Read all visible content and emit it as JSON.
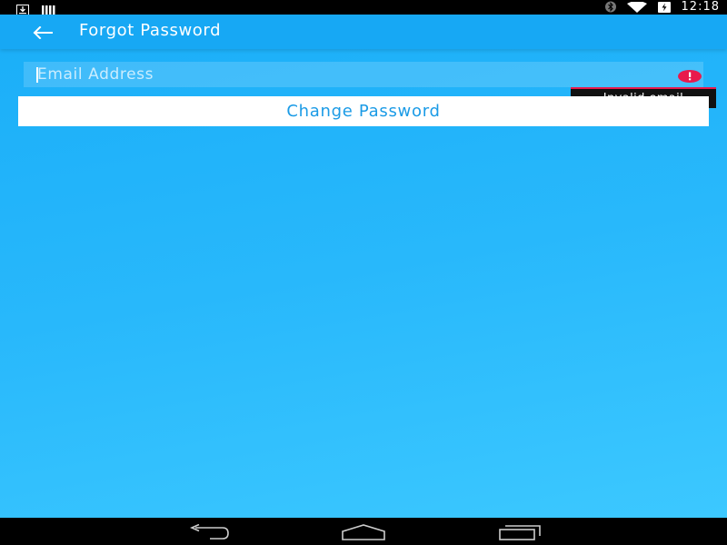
{
  "status_bar": {
    "time": "12:18",
    "icons": [
      "download-icon",
      "signal-bars-icon",
      "bluetooth-icon",
      "wifi-icon",
      "battery-charging-icon"
    ]
  },
  "toolbar": {
    "back_icon": "arrow-left-icon",
    "title": "Forgot Password"
  },
  "form": {
    "email_placeholder": "Email Address",
    "email_value": "",
    "error_icon": "alert-circle-icon",
    "error_message": "Invalid email",
    "submit_label": "Change Password"
  },
  "nav_bar": {
    "icons": [
      "nav-back-icon",
      "nav-home-icon",
      "nav-recents-icon"
    ]
  },
  "colors": {
    "toolbar": "#17a8f4",
    "background_top": "#1aaef8",
    "background_bottom": "#3cc8ff",
    "accent_text": "#1b9be6",
    "error": "#e8194c"
  }
}
